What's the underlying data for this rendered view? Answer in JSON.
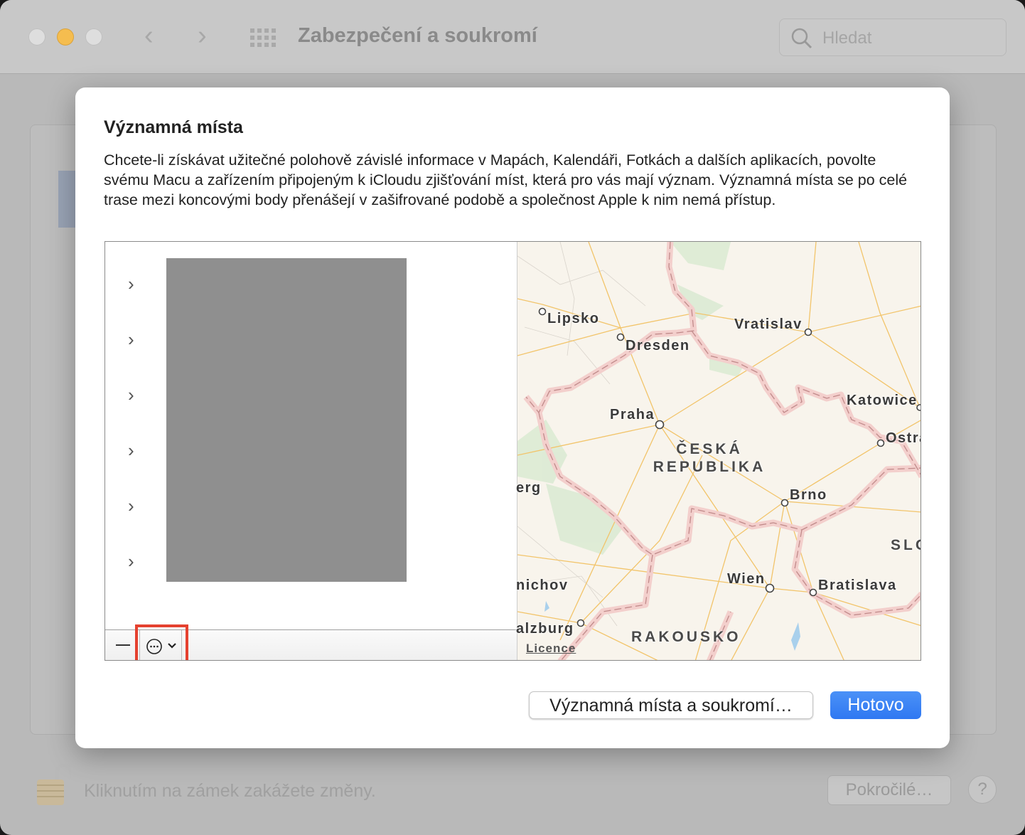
{
  "window": {
    "title": "Zabezpečení a soukromí",
    "search_placeholder": "Hledat",
    "lock_text": "Kliknutím na zámek zakážete změny.",
    "advanced_label": "Pokročilé…",
    "help_label": "?"
  },
  "dialog": {
    "title": "Významná místa",
    "description": "Chcete-li získávat užitečné polohově závislé informace v Mapách, Kalendáři, Fotkách a dalších aplikacích, povolte svému Macu a zařízením připojeným k iCloudu zjišťování míst, která pro vás mají význam. Významná místa se po celé trase mezi koncovými body přenášejí v zašifrované podobě a společnost Apple k nim nemá přístup.",
    "list_rows": 6,
    "remove_label": "—",
    "map": {
      "cities": [
        "Lipsko",
        "Dresden",
        "Vratislav",
        "Praha",
        "Katowice",
        "Ostra",
        "erg",
        "Brno",
        "nichov",
        "Wien",
        "Bratislava",
        "alzburg"
      ],
      "countries": [
        "ČESKÁ REPUBLIKA",
        "RAKOUSKO",
        "SLO"
      ],
      "license": "Licence"
    },
    "privacy_button": "Významná místa a soukromí…",
    "done_button": "Hotovo"
  },
  "colors": {
    "accent": "#2f78f2",
    "highlight": "#e5412f"
  }
}
